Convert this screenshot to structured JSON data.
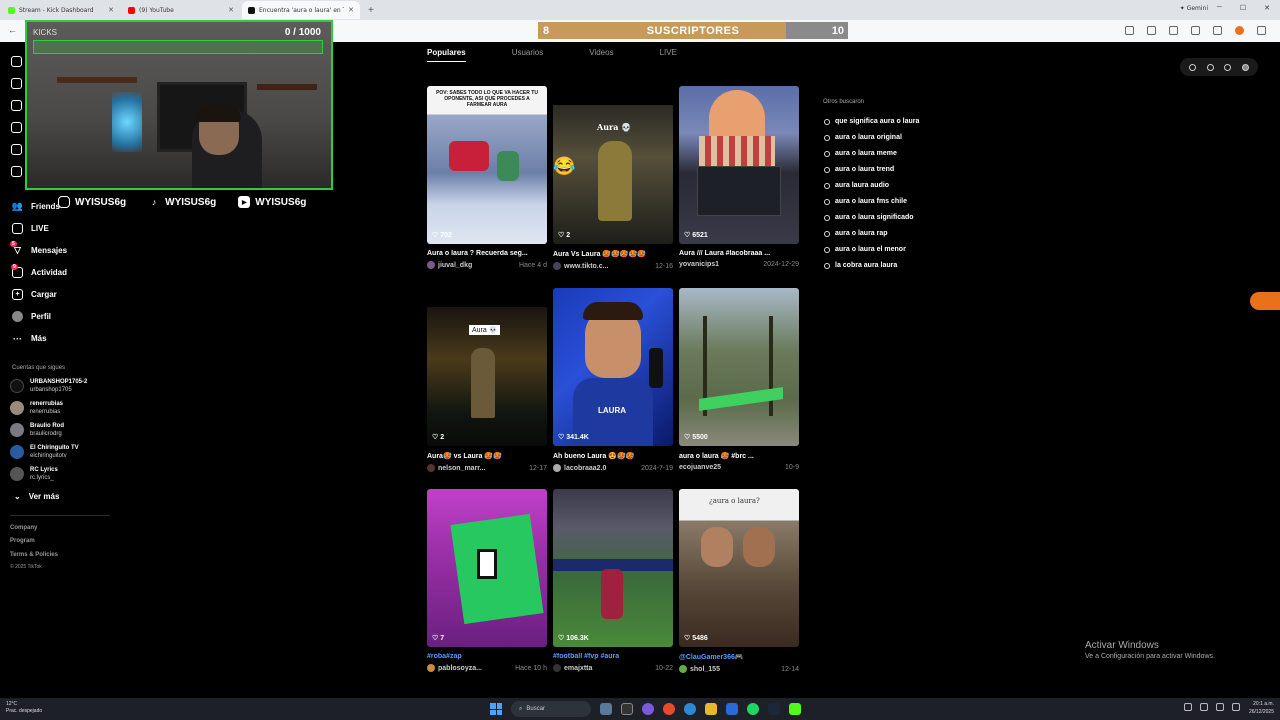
{
  "browser": {
    "tabs": [
      {
        "label": "Stream - Kick Dashboard",
        "color": "#53fc18",
        "active": false
      },
      {
        "label": "(9) YouTube",
        "color": "#ff0000",
        "active": false
      },
      {
        "label": "Encuentra 'aura o laura' en TikT...",
        "color": "#111111",
        "active": true
      }
    ],
    "new_tab": "+",
    "gemini": "✦ Gemini"
  },
  "overlay": {
    "sub_left": "8",
    "sub_title": "SUSCRIPTORES",
    "sub_right": "10",
    "sub_progress": 0.8,
    "cam_label": "KICKS",
    "cam_count": "0 / 1000",
    "socials": [
      {
        "icon": "instagram-icon",
        "handle": "WYISUS6g"
      },
      {
        "icon": "tiktok-icon",
        "handle": "WYISUS6g"
      },
      {
        "icon": "youtube-icon",
        "handle": "WYISUS6g"
      }
    ]
  },
  "sidebar": {
    "items": [
      {
        "label": "Friends",
        "icon": "friends-icon"
      },
      {
        "label": "LIVE",
        "icon": "live-icon"
      },
      {
        "label": "Mensajes",
        "icon": "messages-icon",
        "badge": "5"
      },
      {
        "label": "Actividad",
        "icon": "activity-icon",
        "badge": "9"
      },
      {
        "label": "Cargar",
        "icon": "upload-icon"
      },
      {
        "label": "Perfil",
        "icon": "profile-icon"
      },
      {
        "label": "Más",
        "icon": "more-icon"
      }
    ],
    "following_title": "Cuentas que sigues",
    "following": [
      {
        "name": "URBANSHOP1705-2",
        "handle": "urbanshop1705"
      },
      {
        "name": "renerrubias",
        "handle": "renerrubias"
      },
      {
        "name": "Braulio Rod",
        "handle": "braulicrodrg"
      },
      {
        "name": "El Chiringuito TV",
        "handle": "elchiringuitotv"
      },
      {
        "name": "RC Lyrics",
        "handle": "rc.lyrics_"
      }
    ],
    "ver_mas": "Ver más",
    "footer": [
      "Company",
      "Program",
      "Terms & Policies",
      "© 2025 TikTok"
    ]
  },
  "main": {
    "tabs": [
      "Populares",
      "Usuarios",
      "Videos",
      "LIVE"
    ],
    "cards": [
      {
        "likes": "702",
        "caption": "Aura o laura ? Recuerda seg...",
        "user": "jiuval_dkg",
        "date": "Hace 4 d"
      },
      {
        "likes": "2",
        "caption": "Aura Vs Laura 🥵🥵🥵🥵🥵",
        "user": "www.tikto.c...",
        "date": "12-16"
      },
      {
        "likes": "6521",
        "caption": "Aura /// Laura #lacobraaa ...",
        "user": "yovanicips1",
        "date": "2024-12-29"
      },
      {
        "likes": "2",
        "caption": "Aura🥵 vs Laura 🥵🥵",
        "user": "nelson_marr...",
        "date": "12-17"
      },
      {
        "likes": "341.4K",
        "caption": "Ah bueno Laura 😍🥵🥵",
        "user": "lacobraaa2.0",
        "date": "2024-7-19"
      },
      {
        "likes": "5500",
        "caption": "aura o laura 🥵 #brc ...",
        "user": "ecojuanve25",
        "date": "10-9"
      },
      {
        "likes": "7",
        "caption": "#roba#zap",
        "user": "pablosoyza...",
        "date": "Hace 10 h"
      },
      {
        "likes": "106.3K",
        "caption": "#football #fvp #aura",
        "user": "emajxtta",
        "date": "10-22"
      },
      {
        "likes": "5486",
        "caption": "@ClauGamer366🎮",
        "user": "shol_155",
        "date": "12-14"
      }
    ],
    "overlay_texts": {
      "t1": "POV: SABES TODO LO QUE VA HACER TU OPONENTE, ASI QUE PROCEDES A FARMEAR AURA",
      "t2": "Aura 💀",
      "t5": "LAURA",
      "t9": "¿aura o laura?"
    }
  },
  "related": {
    "title": "Otros buscaron",
    "items": [
      "que significa aura o laura",
      "aura o laura original",
      "aura o laura meme",
      "aura o laura trend",
      "aura laura audio",
      "aura o laura fms chile",
      "aura o laura significado",
      "aura o laura rap",
      "aura o laura el menor",
      "la cobra aura laura"
    ]
  },
  "windows": {
    "activate_title": "Activar Windows",
    "activate_sub": "Ve a Configuración para activar Windows.",
    "search": "Buscar",
    "weather_temp": "12°C",
    "weather_desc": "Prac. despejado",
    "time": "20:1 a.m.",
    "date": "26/12/2025"
  }
}
